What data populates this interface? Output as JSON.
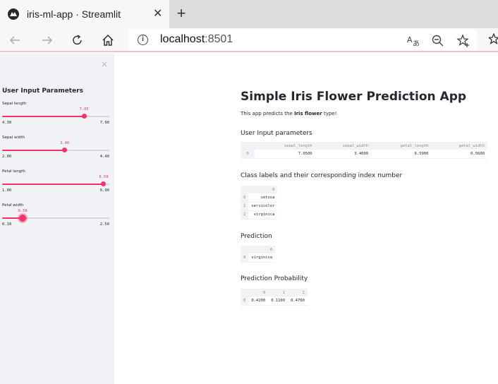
{
  "browser": {
    "tab_title": "iris-ml-app · Streamlit",
    "close_glyph": "✕",
    "new_tab_glyph": "+",
    "url_host": "localhost",
    "url_port": ":8501"
  },
  "sidebar": {
    "close_glyph": "×",
    "heading": "User Input Parameters",
    "sliders": [
      {
        "label": "Sepal length",
        "value": "7.05",
        "min": "4.30",
        "max": "7.90",
        "fraction": 0.764
      },
      {
        "label": "Sepal width",
        "value": "3.40",
        "min": "2.00",
        "max": "4.40",
        "fraction": 0.583
      },
      {
        "label": "Petal length",
        "value": "6.59",
        "min": "1.00",
        "max": "6.90",
        "fraction": 0.947
      },
      {
        "label": "Petal width",
        "value": "0.56",
        "min": "0.10",
        "max": "2.50",
        "fraction": 0.192
      }
    ]
  },
  "main": {
    "title": "Simple Iris Flower Prediction App",
    "desc_prefix": "This app predicts the ",
    "desc_bold": "Iris flower",
    "desc_suffix": " type!",
    "input_section": {
      "heading": "User Input parameters",
      "columns": [
        "",
        "sepal_length",
        "sepal_width",
        "petal_length",
        "petal_width"
      ],
      "rows": [
        [
          "0",
          "7.0500",
          "3.4000",
          "6.5900",
          "0.5600"
        ]
      ]
    },
    "labels_section": {
      "heading": "Class labels and their corresponding index number",
      "columns": [
        "",
        "0"
      ],
      "rows": [
        [
          "0",
          "setosa"
        ],
        [
          "1",
          "versicolor"
        ],
        [
          "2",
          "virginica"
        ]
      ]
    },
    "prediction_section": {
      "heading": "Prediction",
      "columns": [
        "",
        "0"
      ],
      "rows": [
        [
          "0",
          "virginica"
        ]
      ]
    },
    "probability_section": {
      "heading": "Prediction Probability",
      "columns": [
        "",
        "0",
        "1",
        "2"
      ],
      "rows": [
        [
          "0",
          "0.4200",
          "0.1100",
          "0.4700"
        ]
      ]
    }
  },
  "colors": {
    "accent": "#f63366",
    "sidebar_bg": "#f0f2f6",
    "text": "#262730"
  }
}
